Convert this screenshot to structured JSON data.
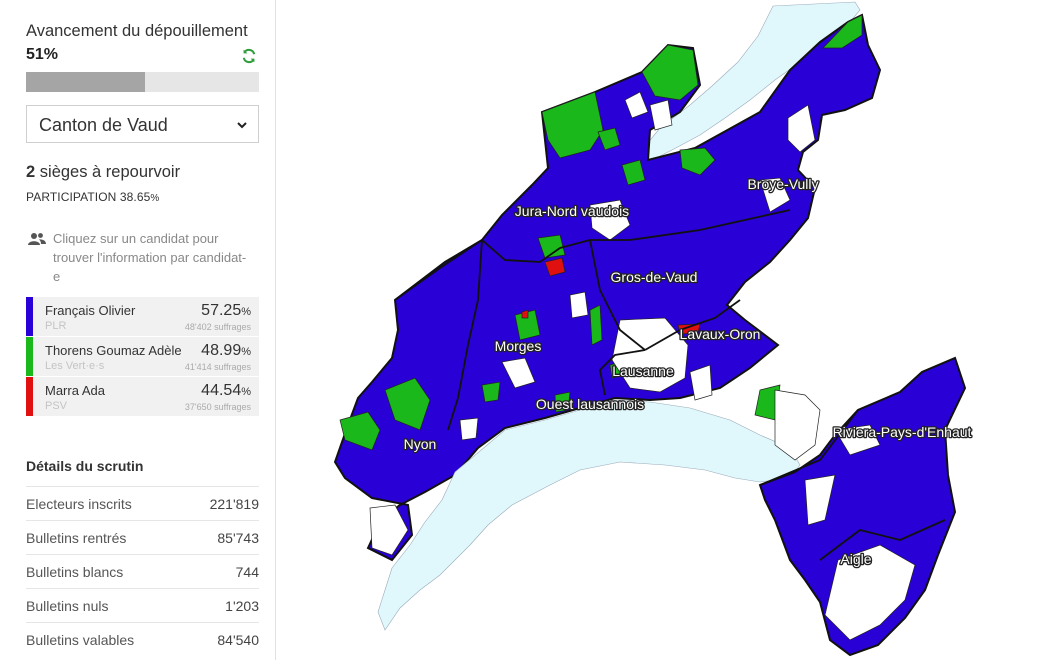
{
  "sidebar": {
    "progress_title": "Avancement du dépouillement",
    "progress_value": "51%",
    "progress_fraction": 0.51,
    "refresh_icon": "refresh-icon",
    "region_select": {
      "selected": "Canton de Vaud",
      "icon": "chevron-down-icon"
    },
    "seats_count": "2",
    "seats_text": " sièges à repourvoir",
    "participation_label": "PARTICIPATION 38.65",
    "participation_unit": "%",
    "hint_icon": "users-icon",
    "hint": "Cliquez sur un candidat pour trouver l'information par candidat-e",
    "candidates": [
      {
        "name": "Français Olivier",
        "party": "PLR",
        "percent": "57.25",
        "unit": "%",
        "votes": "48'402 suffrages",
        "color": "#2900d6"
      },
      {
        "name": "Thorens Goumaz Adèle",
        "party": "Les Vert·e·s",
        "percent": "48.99",
        "unit": "%",
        "votes": "41'414 suffrages",
        "color": "#1ab81a"
      },
      {
        "name": "Marra Ada",
        "party": "PSV",
        "percent": "44.54",
        "unit": "%",
        "votes": "37'650 suffrages",
        "color": "#e01010"
      }
    ],
    "details_title": "Détails du scrutin",
    "details": [
      {
        "label": "Electeurs inscrits",
        "value": "221'819"
      },
      {
        "label": "Bulletins rentrés",
        "value": "85'743"
      },
      {
        "label": "Bulletins blancs",
        "value": "744"
      },
      {
        "label": "Bulletins nuls",
        "value": "1'203"
      },
      {
        "label": "Bulletins valables",
        "value": "84'540"
      }
    ]
  },
  "map": {
    "colors": {
      "lake": "#e0f8fb",
      "winner_a": "#2900d6",
      "winner_b": "#1ab81a",
      "winner_c": "#e01010",
      "not_counted": "#ffffff",
      "border": "#111111"
    },
    "districts": [
      {
        "name": "Jura-Nord vaudois"
      },
      {
        "name": "Broye-Vully"
      },
      {
        "name": "Gros-de-Vaud"
      },
      {
        "name": "Lavaux-Oron"
      },
      {
        "name": "Morges"
      },
      {
        "name": "Lausanne"
      },
      {
        "name": "Ouest lausannois"
      },
      {
        "name": "Riviera-Pays-d'Enhaut"
      },
      {
        "name": "Nyon"
      },
      {
        "name": "Aigle"
      }
    ]
  }
}
